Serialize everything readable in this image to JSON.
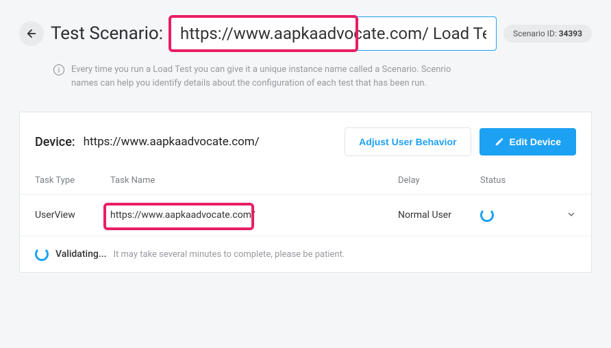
{
  "header": {
    "scenario_label": "Test Scenario:",
    "scenario_value": "https://www.aapkaadvocate.com/ Load Test",
    "scenario_id_label": "Scenario ID:",
    "scenario_id_value": "34393"
  },
  "info": {
    "text": "Every time you run a Load Test you can give it a unique instance name called a Scenario. Scenrio names can help you identify details about the configuration of each test that has been run."
  },
  "device": {
    "label": "Device:",
    "url": "https://www.aapkaadvocate.com/",
    "adjust_label": "Adjust User Behavior",
    "edit_label": "Edit Device"
  },
  "table": {
    "headers": {
      "task_type": "Task Type",
      "task_name": "Task Name",
      "delay": "Delay",
      "status": "Status"
    },
    "row": {
      "task_type": "UserView",
      "task_name": "https://www.aapkaadvocate.com/",
      "delay": "Normal User"
    }
  },
  "validating": {
    "label": "Validating...",
    "note": "It may take several minutes to complete, please be patient."
  }
}
